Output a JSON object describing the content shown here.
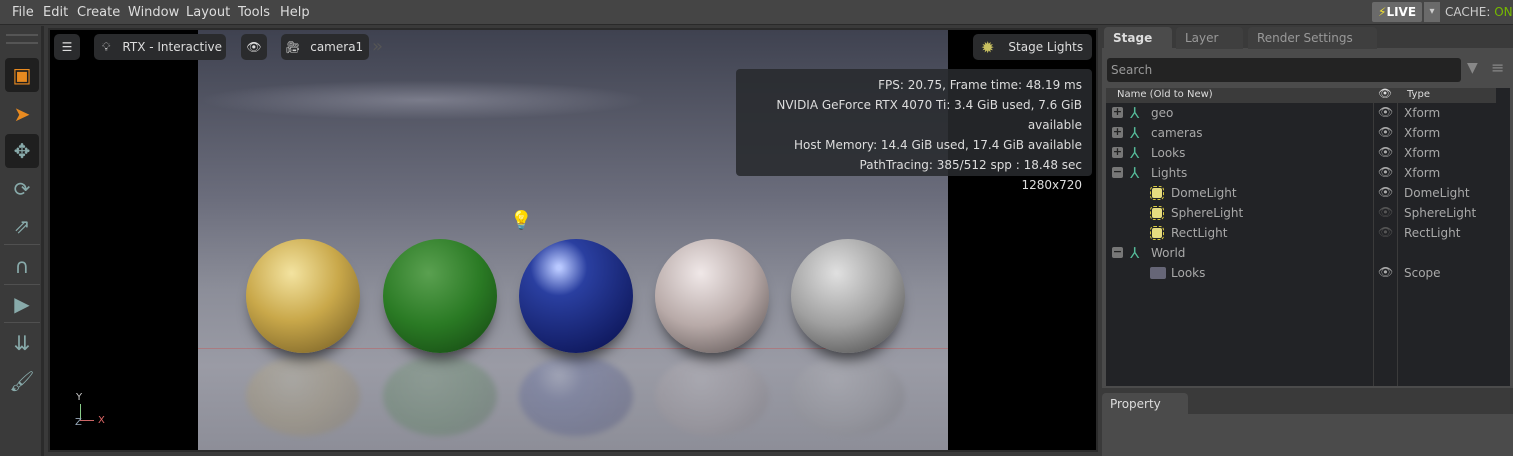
{
  "menu": [
    "File",
    "Edit",
    "Create",
    "Window",
    "Layout",
    "Tools",
    "Help"
  ],
  "status": {
    "live": "LIVE",
    "cache_label": "CACHE:",
    "cache_value": "ON",
    "cache_color": "#76b900"
  },
  "toolbar": [
    "select-mode-icon",
    "pointer-icon",
    "move-icon",
    "rotate-icon",
    "scale-icon",
    "snap-magnet-icon",
    "play-icon",
    "drop-physics-icon",
    "paint-brush-icon"
  ],
  "viewport": {
    "renderer": "RTX - Interactive",
    "camera": "camera1",
    "lights": "Stage Lights",
    "hud": [
      "FPS: 20.75, Frame time: 48.19 ms",
      "NVIDIA GeForce RTX 4070 Ti: 3.4 GiB used, 7.6 GiB available",
      "Host Memory: 14.4 GiB used, 17.4 GiB available",
      "PathTracing: 385/512 spp : 18.48 sec",
      "1280x720"
    ],
    "axis": {
      "y": "Y",
      "z": "Z",
      "x": "X"
    }
  },
  "panel": {
    "tabs": [
      "Stage",
      "Layer",
      "Render Settings"
    ],
    "search_placeholder": "Search",
    "col_name": "Name (Old to New)",
    "col_type": "Type",
    "rows": [
      {
        "name": "geo",
        "type": "Xform",
        "icon": "xform",
        "exp": "+",
        "depth": 0,
        "visible": true
      },
      {
        "name": "cameras",
        "type": "Xform",
        "icon": "xform",
        "exp": "+",
        "depth": 0,
        "visible": true
      },
      {
        "name": "Looks",
        "type": "Xform",
        "icon": "xform",
        "exp": "+",
        "depth": 0,
        "visible": true
      },
      {
        "name": "Lights",
        "type": "Xform",
        "icon": "xform",
        "exp": "-",
        "depth": 0,
        "visible": true
      },
      {
        "name": "DomeLight",
        "type": "DomeLight",
        "icon": "light",
        "exp": "",
        "depth": 1,
        "visible": true
      },
      {
        "name": "SphereLight",
        "type": "SphereLight",
        "icon": "light",
        "exp": "",
        "depth": 1,
        "visible": false
      },
      {
        "name": "RectLight",
        "type": "RectLight",
        "icon": "light",
        "exp": "",
        "depth": 1,
        "visible": false
      },
      {
        "name": "World",
        "type": "",
        "icon": "xform",
        "exp": "-",
        "depth": 0,
        "visible": null
      },
      {
        "name": "Looks",
        "type": "Scope",
        "icon": "folder",
        "exp": "",
        "depth": 1,
        "visible": true
      }
    ],
    "property_tab": "Property"
  }
}
